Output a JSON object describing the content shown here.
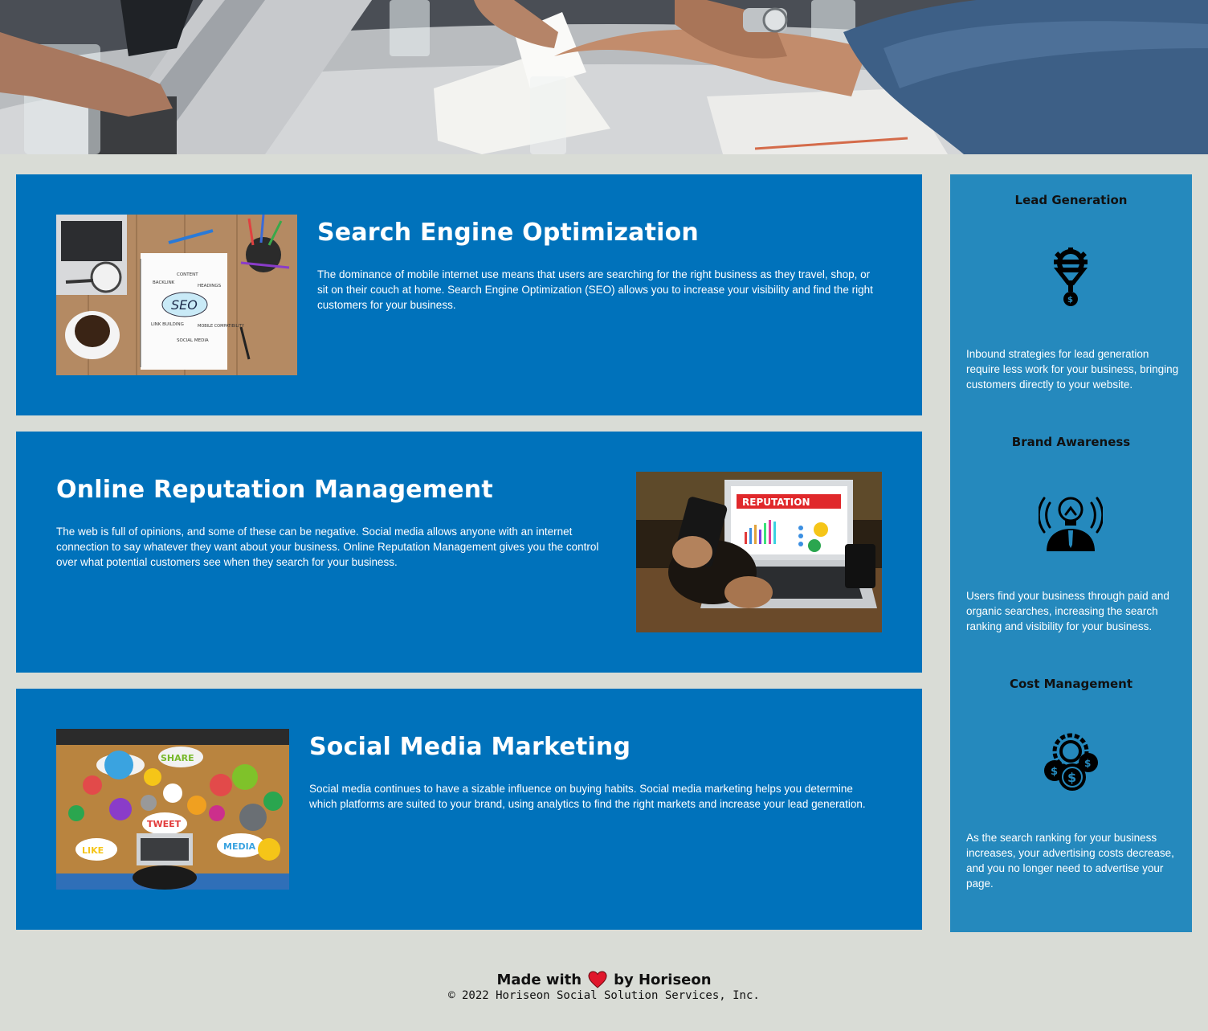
{
  "sections": [
    {
      "id": "search-engine-optimization",
      "title": "Search Engine Optimization",
      "text": "The dominance of mobile internet use means that users are searching for the right business as they travel, shop, or sit on their couch at home. Search Engine Optimization (SEO) allows you to increase your visibility and find the right customers for your business.",
      "image_labels": [
        "CONTENT",
        "BACKLINK",
        "HEADINGS",
        "SEO",
        "LINK BUILDING",
        "MOBILE COMPATIBILITY",
        "SOCIAL MEDIA"
      ]
    },
    {
      "id": "online-reputation-management",
      "title": "Online Reputation Management",
      "text": "The web is full of opinions, and some of these can be negative. Social media allows anyone with an internet connection to say whatever they want about your business. Online Reputation Management gives you the control over what potential customers see when they search for your business.",
      "image_labels": [
        "REPUTATION"
      ]
    },
    {
      "id": "social-media-marketing",
      "title": "Social Media Marketing",
      "text": "Social media continues to have a sizable influence on buying habits. Social media marketing helps you determine which platforms are suited to your brand, using analytics to find the right markets and increase your lead generation.",
      "image_labels": [
        "SHARE",
        "TWEET",
        "LIKE",
        "MEDIA"
      ]
    }
  ],
  "sidebar": [
    {
      "title": "Lead Generation",
      "icon": "lead-funnel-icon",
      "text": "Inbound strategies for lead generation require less work for your business, bringing customers directly to your website."
    },
    {
      "title": "Brand Awareness",
      "icon": "brand-lightbulb-icon",
      "text": "Users find your business through paid and organic searches, increasing the search ranking and visibility for your business."
    },
    {
      "title": "Cost Management",
      "icon": "cost-gear-coins-icon",
      "text": "As the search ranking for your business increases, your advertising costs decrease, and you no longer need to advertise your page."
    }
  ],
  "footer": {
    "made_with": "Made with",
    "by": "by Horiseon",
    "copyright": "© 2022 Horiseon Social Solution Services, Inc."
  },
  "colors": {
    "page_bg": "#d9dcd6",
    "card_bg": "#0072bb",
    "sidebar_bg": "#2589bd",
    "heart": "#e0162b"
  }
}
